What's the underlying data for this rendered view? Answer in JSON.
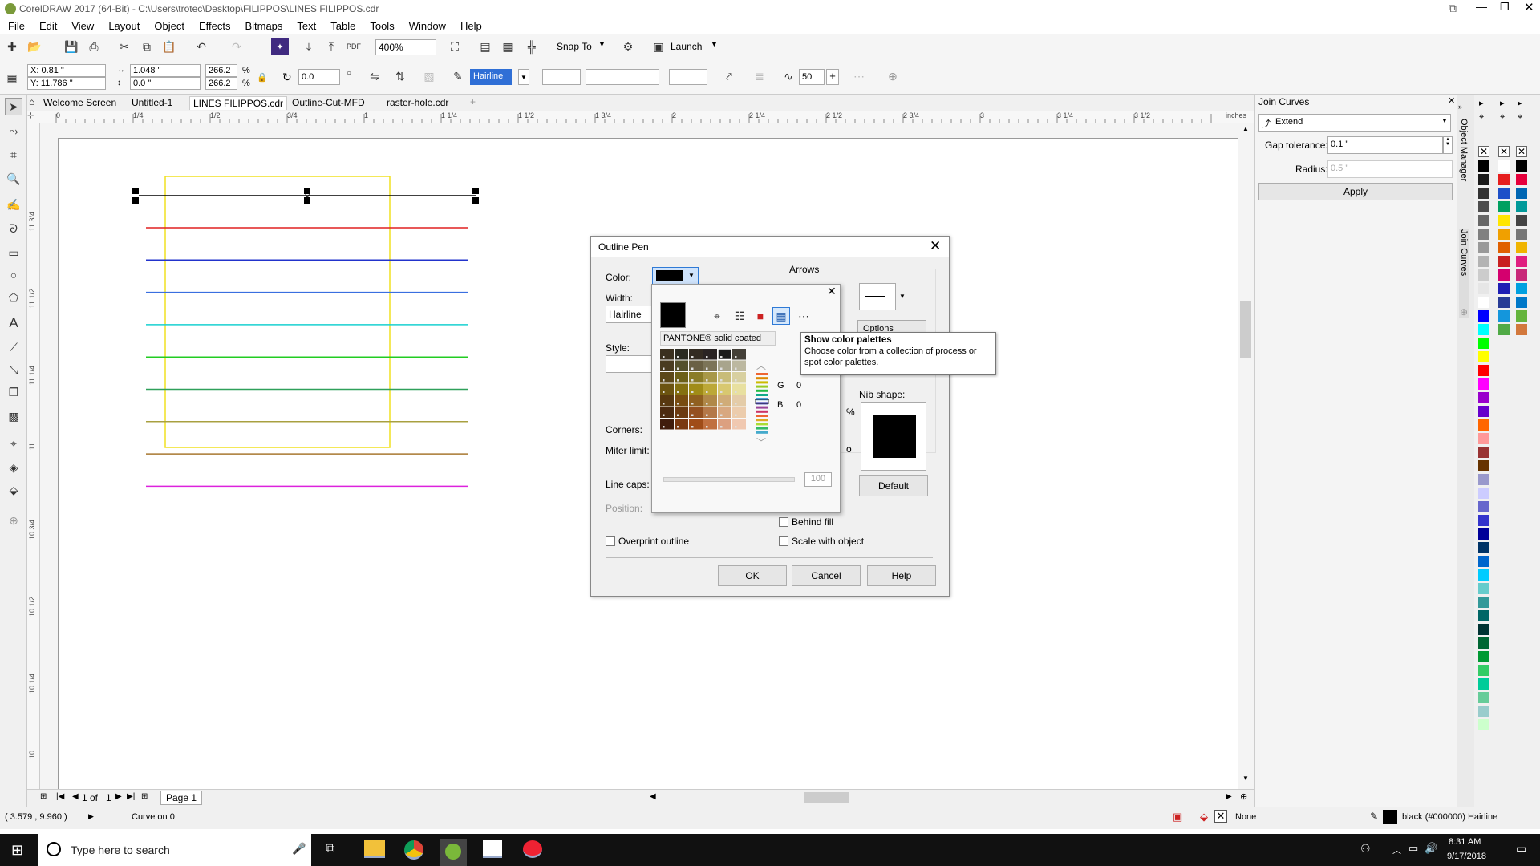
{
  "titlebar": {
    "title": "CorelDRAW 2017 (64-Bit) - C:\\Users\\trotec\\Desktop\\FILIPPOS\\LINES FILIPPOS.cdr"
  },
  "menubar": [
    "File",
    "Edit",
    "View",
    "Layout",
    "Object",
    "Effects",
    "Bitmaps",
    "Text",
    "Table",
    "Tools",
    "Window",
    "Help"
  ],
  "toolbar1": {
    "zoom": "400%",
    "snap_to": "Snap To",
    "launch": "Launch"
  },
  "toolbar2": {
    "x": "X: 0.81 \"",
    "y": "Y: 11.786 \"",
    "w": "1.048 \"",
    "h": "0.0 \"",
    "sx": "266.2",
    "sy": "266.2",
    "pct": "%",
    "rot": "0.0",
    "outline_width": "Hairline",
    "smooth": "50"
  },
  "doc_tabs": [
    "Welcome Screen",
    "Untitled-1",
    "LINES FILIPPOS.cdr",
    "Outline-Cut-MFD",
    "raster-hole.cdr"
  ],
  "ruler": {
    "h": [
      "0",
      "1/4",
      "1/2",
      "3/4",
      "1",
      "1 1/4",
      "1 1/2",
      "1 3/4",
      "2",
      "2 1/4",
      "2 1/2",
      "2 3/4",
      "3",
      "3 1/4",
      "3 1/2"
    ],
    "unit": "inches",
    "v": [
      "11 3/4",
      "11 1/2",
      "11 1/4",
      "11",
      "10 3/4",
      "10 1/2",
      "10 1/4",
      "10"
    ]
  },
  "drawing": {
    "line_colors": [
      "#e02020",
      "#2233cc",
      "#3a6fe0",
      "#18d0d0",
      "#22cc22",
      "#2fa05a",
      "#a8a040",
      "#a87830",
      "#dd22dd"
    ],
    "frame_color": "#f0e020"
  },
  "join_curves": {
    "title": "Join Curves",
    "mode": "Extend",
    "gap_label": "Gap tolerance:",
    "gap_value": "0.1 \"",
    "radius_label": "Radius:",
    "radius_value": "0.5 \"",
    "apply": "Apply"
  },
  "docker_tabs": [
    "Object Manager",
    "Join Curves"
  ],
  "dialog": {
    "title": "Outline Pen",
    "color_label": "Color:",
    "width_label": "Width:",
    "width_value": "Hairline",
    "style_label": "Style:",
    "arrows_label": "Arrows",
    "options_label": "Options",
    "corners_label": "Corners:",
    "miter_label": "Miter limit:",
    "linecaps_label": "Line caps:",
    "position_label": "Position:",
    "nib_label": "Nib shape:",
    "default_btn": "Default",
    "behind_fill": "Behind fill",
    "scale_with_object": "Scale with object",
    "overprint": "Overprint outline",
    "ok": "OK",
    "cancel": "Cancel",
    "help": "Help",
    "pct_symbol": "%",
    "deg_symbol": "o"
  },
  "palette_popup": {
    "palette_name": "PANTONE® solid coated",
    "g_label": "G",
    "g_value": "0",
    "b_label": "B",
    "b_value": "0",
    "slider_value": "100"
  },
  "tooltip": {
    "title": "Show color palettes",
    "body": "Choose color from a collection of process or spot color palettes."
  },
  "page_nav": {
    "pos": "1",
    "of": "of",
    "total": "1",
    "page_tab": "Page 1"
  },
  "status": {
    "coords": "( 3.579 , 9.960 )",
    "object": "Curve on 0",
    "fill": "None",
    "outline": "black (#000000)  Hairline"
  },
  "taskbar": {
    "search": "Type here to search",
    "time": "8:31 AM",
    "date": "9/17/2018"
  },
  "palette_colors_1": [
    "#000000",
    "#1a1a1a",
    "#333333",
    "#4d4d4d",
    "#666666",
    "#808080",
    "#999999",
    "#b3b3b3",
    "#cccccc",
    "#e6e6e6",
    "#ffffff",
    "#0000ff",
    "#00ffff",
    "#00ff00",
    "#ffff00",
    "#ff0000",
    "#ff00ff",
    "#9900cc",
    "#6600cc",
    "#ff6600",
    "#ff9999",
    "#993333",
    "#663300",
    "#9999cc",
    "#ccccff",
    "#6666cc",
    "#3333cc",
    "#000099",
    "#003366",
    "#0066cc",
    "#00ccff",
    "#66cccc",
    "#339999",
    "#006666",
    "#003333",
    "#006633",
    "#009933",
    "#33cc66",
    "#00cc99",
    "#66cc99",
    "#99cccc",
    "#ccffcc"
  ],
  "palette_colors_2": [
    [
      "#ffffff",
      "#000000"
    ],
    [
      "#e61e1e",
      "#e6003c"
    ],
    [
      "#1e50c8",
      "#0066b3"
    ],
    [
      "#00a060",
      "#009999"
    ],
    [
      "#ffe600",
      "#444444"
    ],
    [
      "#f0a000",
      "#777777"
    ],
    [
      "#e06000",
      "#f0b400"
    ],
    [
      "#c82020",
      "#e01e80"
    ],
    [
      "#d4006e",
      "#c82878"
    ],
    [
      "#1e1eb4",
      "#00a0e0"
    ],
    [
      "#283c96",
      "#0078c8"
    ],
    [
      "#1496dc",
      "#64b43c"
    ],
    [
      "#50aa46",
      "#d2783c"
    ]
  ],
  "pantone_grid": [
    [
      "#3a3020",
      "#2a2a22",
      "#332b22",
      "#2a2424",
      "#1c1c1c",
      "#444038"
    ],
    [
      "#4a3c20",
      "#54502c",
      "#6a6044",
      "#7c7458",
      "#a8a48c",
      "#bcb8a0"
    ],
    [
      "#5c4818",
      "#6c6018",
      "#8a7c28",
      "#a89848",
      "#c8bc78",
      "#d8d0a0"
    ],
    [
      "#6c5410",
      "#847010",
      "#a08c18",
      "#bca838",
      "#d8c870",
      "#e8e0a0"
    ],
    [
      "#583810",
      "#784c10",
      "#906020",
      "#b08848",
      "#d0ac78",
      "#e4cca8"
    ],
    [
      "#4c2a10",
      "#6c3a10",
      "#945020",
      "#b47848",
      "#d8a880",
      "#ecccac"
    ],
    [
      "#401c0c",
      "#7a3810",
      "#a04c18",
      "#c07040",
      "#dca080",
      "#f0c8b0"
    ]
  ]
}
